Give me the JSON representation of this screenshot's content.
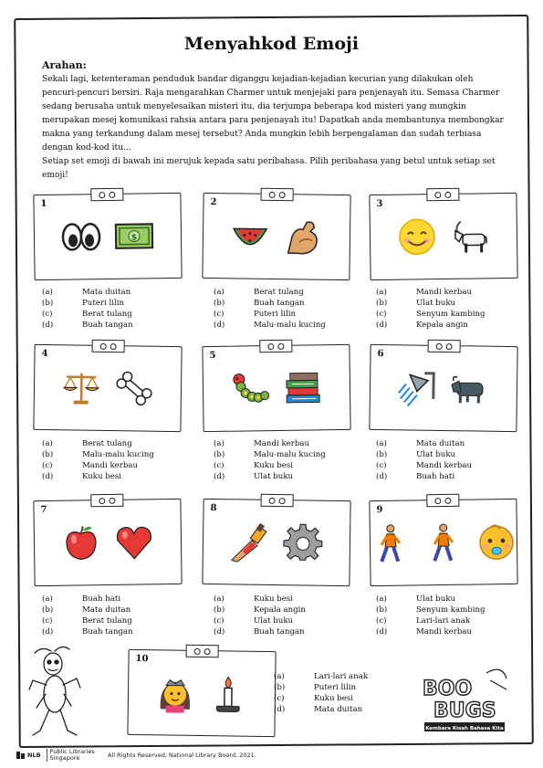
{
  "title": "Menyahkod Emoji",
  "arahan_label": "Arahan:",
  "intro": "Sekali lagi, ketenteraman penduduk bandar diganggu kejadian-kejadian kecurian yang dilakukan oleh pencuri-pencuri bersiri. Raja mengarahkan Charmer untuk menjejaki para penjenayah itu. Semasa Charmer sedang berusaha untuk menyelesaikan misteri itu, dia terjumpa beberapa kod misteri yang mungkin merupakan mesej komunikasi rahsia antara para penjenayah itu! Dapatkah anda membantunya membongkar makna yang terkandung dalam mesej tersebut? Anda mungkin lebih berpengalaman dan sudah terbiasa dengan kod-kod itu...",
  "instruction": "Setiap set emoji di bawah ini merujuk kepada satu peribahasa. Pilih peribahasa yang betul untuk setiap set emoji!",
  "letters": [
    "(a)",
    "(b)",
    "(c)",
    "(d)"
  ],
  "puzzles": [
    {
      "number": "1",
      "emojis": [
        "eyes-icon",
        "money-icon"
      ],
      "options": [
        "Mata duitan",
        "Puteri lilin",
        "Berat tulang",
        "Buah tangan"
      ]
    },
    {
      "number": "2",
      "emojis": [
        "watermelon-icon",
        "flexed-biceps-icon"
      ],
      "options": [
        "Berat tulang",
        "Buah tangan",
        "Puteri lilin",
        "Malu-malu kucing"
      ]
    },
    {
      "number": "3",
      "emojis": [
        "smiling-face-icon",
        "goat-icon"
      ],
      "options": [
        "Mandi kerbau",
        "Ulat buku",
        "Senyum kambing",
        "Kepala angin"
      ]
    },
    {
      "number": "4",
      "emojis": [
        "balance-scale-icon",
        "bone-icon"
      ],
      "options": [
        "Berat tulang",
        "Malu-malu kucing",
        "Mandi kerbau",
        "Kuku besi"
      ]
    },
    {
      "number": "5",
      "emojis": [
        "caterpillar-icon",
        "books-icon"
      ],
      "options": [
        "Mandi kerbau",
        "Malu-malu kucing",
        "Kuku besi",
        "Ulat buku"
      ]
    },
    {
      "number": "6",
      "emojis": [
        "shower-icon",
        "water-buffalo-icon"
      ],
      "options": [
        "Mata duitan",
        "Ulat buku",
        "Mandi kerbau",
        "Buah hati"
      ]
    },
    {
      "number": "7",
      "emojis": [
        "red-apple-icon",
        "red-heart-icon"
      ],
      "options": [
        "Buah hati",
        "Mata duitan",
        "Berat tulang",
        "Buah tangan"
      ]
    },
    {
      "number": "8",
      "emojis": [
        "nail-polish-icon",
        "gear-icon"
      ],
      "options": [
        "Kuku besi",
        "Kepala angin",
        "Ulat buku",
        "Buah tangan"
      ]
    },
    {
      "number": "9",
      "emojis": [
        "person-walking-icon",
        "person-walking-icon",
        "baby-icon"
      ],
      "options": [
        "Ulat buku",
        "Senyum kambing",
        "Lari-lari anak",
        "Mandi kerbau"
      ]
    },
    {
      "number": "10",
      "emojis": [
        "princess-icon",
        "candle-icon"
      ],
      "options": [
        "Lari-lari anak",
        "Puteri lilin",
        "Kuku besi",
        "Mata duitan"
      ]
    }
  ],
  "logo_text": [
    "BOO",
    "BUGS",
    "Kembara Kisah Bahasa Kita"
  ],
  "footer": {
    "nlb_short": "NLB",
    "brand_line1": "Public Libraries",
    "brand_line2": "Singapore",
    "copyright": "All Rights Reserved, National Library Board, 2021."
  }
}
